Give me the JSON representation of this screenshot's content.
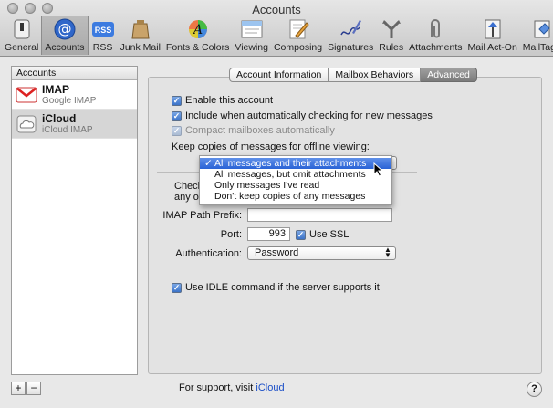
{
  "window": {
    "title": "Accounts"
  },
  "toolbar": {
    "items": [
      {
        "label": "General",
        "icon": "switch-icon"
      },
      {
        "label": "Accounts",
        "icon": "at-icon"
      },
      {
        "label": "RSS",
        "icon": "rss-icon"
      },
      {
        "label": "Junk Mail",
        "icon": "junk-bag-icon"
      },
      {
        "label": "Fonts & Colors",
        "icon": "fonts-colors-icon"
      },
      {
        "label": "Viewing",
        "icon": "viewing-icon"
      },
      {
        "label": "Composing",
        "icon": "composing-icon"
      },
      {
        "label": "Signatures",
        "icon": "signature-icon"
      },
      {
        "label": "Rules",
        "icon": "rules-icon"
      },
      {
        "label": "Attachments",
        "icon": "paperclip-icon"
      },
      {
        "label": "Mail Act-On",
        "icon": "mail-act-on-icon"
      },
      {
        "label": "MailTags",
        "icon": "mailtags-icon"
      }
    ],
    "selected": "Accounts",
    "rss_badge": "RSS"
  },
  "sidebar": {
    "header": "Accounts",
    "accounts": [
      {
        "name": "IMAP",
        "type": "Google IMAP",
        "icon": "gmail-icon"
      },
      {
        "name": "iCloud",
        "type": "iCloud IMAP",
        "icon": "icloud-icon"
      }
    ],
    "add_button": "+",
    "remove_button": "−"
  },
  "tabs": {
    "items": [
      "Account Information",
      "Mailbox Behaviors",
      "Advanced"
    ],
    "active": "Advanced"
  },
  "advanced": {
    "enable_account": {
      "label": "Enable this account",
      "checked": true
    },
    "include_check": {
      "label": "Include when automatically checking for new messages",
      "checked": true
    },
    "compact": {
      "label": "Compact mailboxes automatically",
      "checked": true,
      "disabled": true
    },
    "keep_copies_label": "Keep copies of messages for offline viewing:",
    "keep_copies_options": [
      "All messages and their attachments",
      "All messages, but omit attachments",
      "Only messages I've read",
      "Don't keep copies of any messages"
    ],
    "keep_copies_selected": "All messages and their attachments",
    "check_text_1": "Check",
    "check_text_2": "any of",
    "imap_prefix_label": "IMAP Path Prefix:",
    "imap_prefix_value": "",
    "port_label": "Port:",
    "port_value": "993",
    "use_ssl": {
      "label": "Use SSL",
      "checked": true
    },
    "auth_label": "Authentication:",
    "auth_value": "Password",
    "idle": {
      "label": "Use IDLE command if the server supports it",
      "checked": true
    }
  },
  "footer": {
    "support_text": "For support, visit",
    "support_link": "iCloud",
    "help_button": "?"
  },
  "colors": {
    "highlight": "#2a63d6",
    "link": "#1a4ec7"
  }
}
